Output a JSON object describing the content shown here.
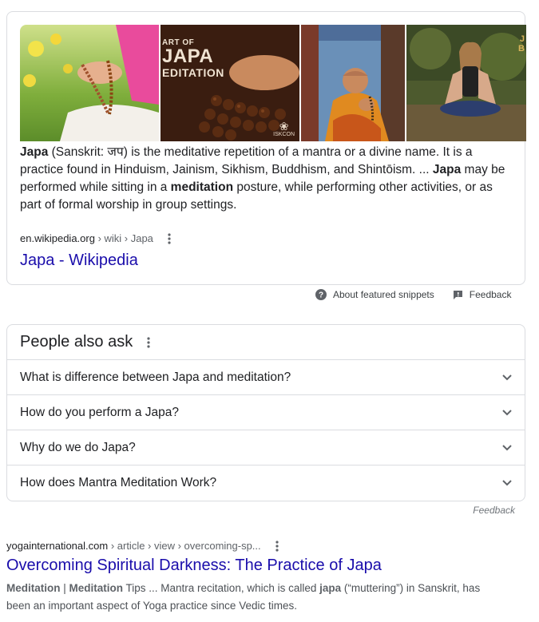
{
  "featured_snippet": {
    "images": [
      {
        "icon": "meditation-hands-mala-image"
      },
      {
        "icon": "japa-meditation-beads-image",
        "caption_small": "ART OF",
        "caption_big": "JAPA",
        "caption_mid": "EDITATION",
        "badge": "ISKCON"
      },
      {
        "icon": "monk-chanting-image"
      },
      {
        "icon": "woman-meditating-forest-image",
        "corner_text": "J\nB"
      }
    ],
    "text_segments": [
      {
        "bold": true,
        "text": "Japa"
      },
      {
        "bold": false,
        "text": " (Sanskrit: जप) is the meditative repetition of a mantra or a divine name. It is a practice found in Hinduism, Jainism, Sikhism, Buddhism, and Shintōism. ... "
      },
      {
        "bold": true,
        "text": "Japa"
      },
      {
        "bold": false,
        "text": " may be performed while sitting in a "
      },
      {
        "bold": true,
        "text": "meditation"
      },
      {
        "bold": false,
        "text": " posture, while performing other activities, or as part of formal worship in group settings."
      }
    ],
    "source_domain": "en.wikipedia.org",
    "source_path": " › wiki › Japa",
    "link_title": "Japa - Wikipedia",
    "footer": {
      "about_label": "About featured snippets",
      "feedback_label": "Feedback"
    }
  },
  "people_also_ask": {
    "title": "People also ask",
    "questions": [
      "What is difference between Japa and meditation?",
      "How do you perform a Japa?",
      "Why do we do Japa?",
      "How does Mantra Meditation Work?"
    ],
    "feedback_label": "Feedback"
  },
  "result": {
    "source_domain": "yogainternational.com",
    "source_path": " › article › view › overcoming-sp...",
    "title": "Overcoming Spiritual Darkness: The Practice of Japa",
    "desc_segments": [
      {
        "bold": true,
        "text": "Meditation"
      },
      {
        "bold": false,
        "text": " | "
      },
      {
        "bold": true,
        "text": "Meditation"
      },
      {
        "bold": false,
        "text": " Tips ... Mantra recitation, which is called "
      },
      {
        "bold": true,
        "text": "japa"
      },
      {
        "bold": false,
        "text": " (“muttering”) in Sanskrit, has been an important aspect of Yoga practice since Vedic times."
      }
    ]
  },
  "colors": {
    "link": "#1a0dab",
    "border": "#dadce0",
    "text": "#202124",
    "secondary_text": "#5f6368"
  }
}
